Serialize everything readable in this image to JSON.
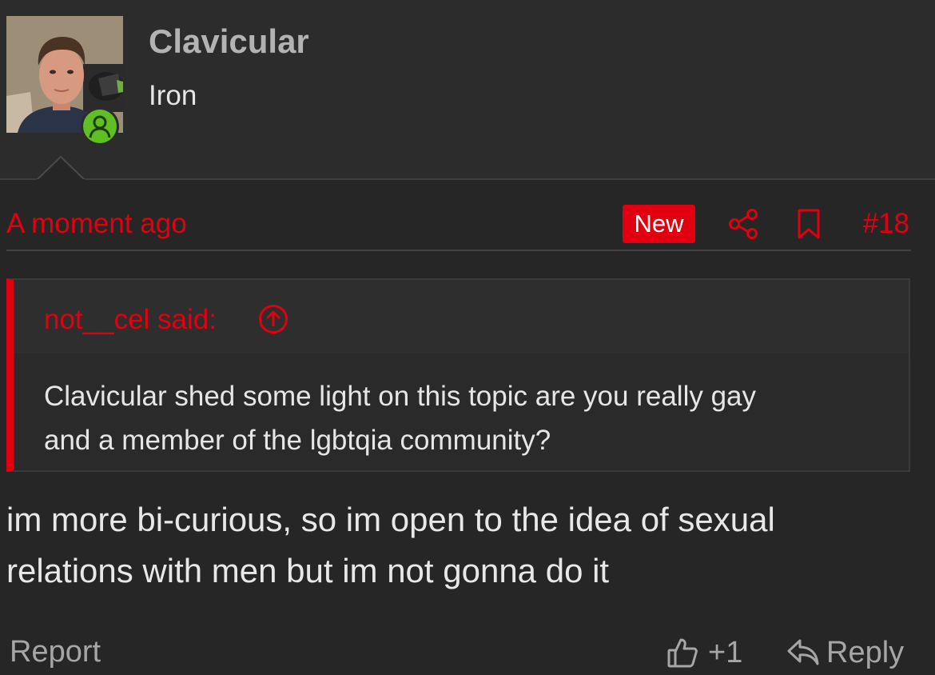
{
  "post": {
    "author": {
      "username": "Clavicular",
      "user_title": "Iron",
      "avatar_icon": "user-photo",
      "online_icon": "user-icon",
      "online_color": "#5fbf24"
    },
    "meta": {
      "timestamp": "A moment ago",
      "new_badge": "New",
      "share_icon": "share-icon",
      "bookmark_icon": "bookmark-icon",
      "post_number": "#18"
    },
    "quote": {
      "author_label": "not__cel said:",
      "jump_icon": "arrow-circle-up-icon",
      "lines": [
        "Clavicular shed some light on this topic are you really gay",
        "and a member of the lgbtqia community?"
      ]
    },
    "message_lines": [
      "im more bi-curious, so im open to the idea of sexual",
      "relations with men but im not gonna do it"
    ],
    "actions": {
      "report_label": "Report",
      "like_icon": "thumbs-up-icon",
      "like_count": "+1",
      "reply_icon": "reply-arrow-icon",
      "reply_label": "Reply"
    }
  },
  "colors": {
    "accent": "#e0000f",
    "background": "#262626",
    "header_background": "#2c2c2c",
    "muted_text": "#a6a6a6"
  }
}
